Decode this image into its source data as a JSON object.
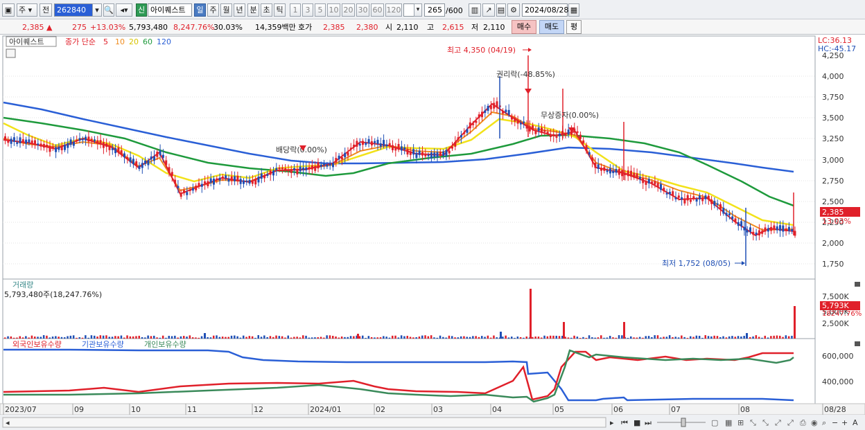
{
  "toolbar": {
    "market": "주",
    "prev": "전",
    "code": "262840",
    "badge": "신",
    "name": "아이퀘스트",
    "periods": [
      "일",
      "주",
      "월",
      "년",
      "분",
      "초",
      "틱"
    ],
    "numbers": [
      "1",
      "3",
      "5",
      "10",
      "20",
      "30",
      "60",
      "120"
    ],
    "count": "265",
    "total": "/600",
    "date": "2024/08/28"
  },
  "info": {
    "price": "2,385",
    "change": "275",
    "change_pct": "+13.03%",
    "volume": "5,793,480",
    "vol_pct": "8,247.76%",
    "turnover": "30.03%",
    "amount": "14,359백만",
    "hoga_label": "호가",
    "bid": "2,385",
    "ask": "2,380",
    "open_label": "시",
    "open": "2,110",
    "high_label": "고",
    "high": "2,615",
    "low_label": "저",
    "low": "2,110",
    "buy": "매수",
    "sell": "매도",
    "eval": "평"
  },
  "price_panel": {
    "name": "아이퀘스트",
    "legend_prefix": "종가 단순",
    "ma": [
      "5",
      "10",
      "20",
      "60",
      "120"
    ],
    "lc": "LC:36.13",
    "hc": "HC:-45.17",
    "y_ticks": [
      "4,250",
      "4,000",
      "3,750",
      "3,500",
      "3,250",
      "3,000",
      "2,750",
      "2,500",
      "2,250",
      "2,000",
      "1,750"
    ],
    "current_tag": "2,385",
    "current_pct": "13.03%",
    "annotations": {
      "high": "최고 4,350 (04/19)",
      "rights": "권리락(-48.85%)",
      "bonus": "무상증자(0.00%)",
      "dividend": "배당락(0.00%)",
      "low": "최저 1,752 (08/05)"
    }
  },
  "volume_panel": {
    "title": "거래량",
    "value": "5,793,480주(18,247.76%)",
    "y_ticks": [
      "7,500K",
      "5,000K",
      "2,500K"
    ],
    "current_tag": "5,793K",
    "current_pct": "18247.76%"
  },
  "holding_panel": {
    "labels": [
      "외국인보유수량",
      "기관보유수량",
      "개인보유수량"
    ],
    "y_ticks": [
      "600,000",
      "400,000"
    ]
  },
  "x_axis": [
    "2023/07",
    "09",
    "10",
    "11",
    "12",
    "2024/01",
    "02",
    "03",
    "04",
    "05",
    "06",
    "07",
    "08",
    "08/28"
  ],
  "colors": {
    "up": "#e0202a",
    "down": "#1f4fb5",
    "ma5": "#e0202a",
    "ma10": "#f08c1e",
    "ma20": "#f2e21a",
    "ma60": "#1e9a3c",
    "ma120": "#2a5fd6",
    "foreign": "#e0202a",
    "inst": "#2a5fd6",
    "retail": "#3a8a5a"
  }
}
